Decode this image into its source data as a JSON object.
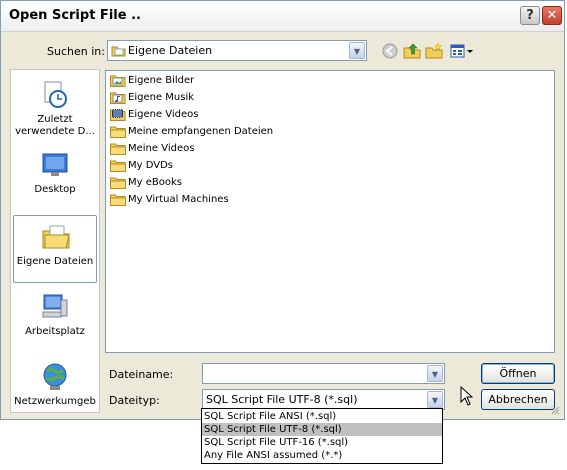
{
  "window": {
    "title": "Open Script File .."
  },
  "titlebar": {
    "help_label": "?",
    "close_label": "✕"
  },
  "look_in": {
    "label": "Suchen in:",
    "value": "Eigene Dateien"
  },
  "toolbar": {
    "back_icon": "back-icon",
    "up_icon": "up-folder-icon",
    "new_folder_icon": "new-folder-icon",
    "views_icon": "views-menu-icon"
  },
  "places": [
    {
      "label": "Zuletzt verwendete D...",
      "icon": "recent-documents-icon"
    },
    {
      "label": "Desktop",
      "icon": "desktop-icon"
    },
    {
      "label": "Eigene Dateien",
      "icon": "my-documents-icon"
    },
    {
      "label": "Arbeitsplatz",
      "icon": "my-computer-icon"
    },
    {
      "label": "Netzwerkumgeb",
      "icon": "network-icon"
    }
  ],
  "files": [
    {
      "name": "Eigene Bilder",
      "icon": "pictures-folder-icon"
    },
    {
      "name": "Eigene Musik",
      "icon": "music-folder-icon"
    },
    {
      "name": "Eigene Videos",
      "icon": "videos-folder-icon"
    },
    {
      "name": "Meine empfangenen Dateien",
      "icon": "folder-icon"
    },
    {
      "name": "Meine Videos",
      "icon": "folder-icon"
    },
    {
      "name": "My DVDs",
      "icon": "folder-icon"
    },
    {
      "name": "My eBooks",
      "icon": "folder-icon"
    },
    {
      "name": "My Virtual Machines",
      "icon": "folder-icon"
    }
  ],
  "filename": {
    "label": "Dateiname:",
    "value": ""
  },
  "filetype": {
    "label": "Dateityp:",
    "value": "SQL Script File UTF-8 (*.sql)",
    "options": [
      "SQL Script File ANSI (*.sql)",
      "SQL Script File UTF-8 (*.sql)",
      "SQL Script File UTF-16 (*.sql)",
      "Any File ANSI assumed (*.*)"
    ]
  },
  "buttons": {
    "open": "Öffnen",
    "cancel": "Abbrechen"
  },
  "colors": {
    "folder": "#f2cf5b",
    "selection": "#c0c0c0",
    "border": "#7f9db9",
    "dialog_bg": "#ece9d8"
  }
}
